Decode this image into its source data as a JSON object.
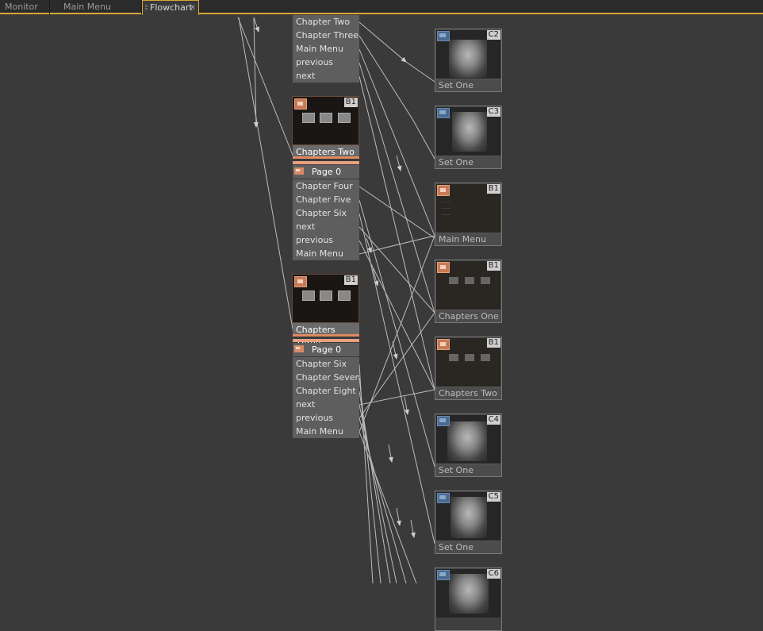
{
  "tabs": [
    {
      "label": "Monitor"
    },
    {
      "label": "Main Menu"
    },
    {
      "label": "Flowchart",
      "active": true,
      "close": "×"
    }
  ],
  "menu_top": {
    "rows": [
      "Chapter Two",
      "Chapter Three",
      "Main Menu",
      "previous",
      "next"
    ]
  },
  "menu_b1a": {
    "tag": "B1",
    "label": "Chapters Two",
    "page": "Page 0",
    "rows": [
      "Chapter Four",
      "Chapter Five",
      "Chapter Six",
      "next",
      "previous",
      "Main Menu"
    ]
  },
  "menu_b1b": {
    "tag": "B1",
    "label": "Chapters Three",
    "page": "Page 0",
    "rows": [
      "Chapter Six",
      "Chapter Seven",
      "Chapter Eight",
      "next",
      "previous",
      "Main Menu"
    ]
  },
  "nodes": [
    {
      "tag": "C2",
      "label": "Set One"
    },
    {
      "tag": "C3",
      "label": "Set One"
    },
    {
      "tag": "B1",
      "label": "Main Menu"
    },
    {
      "tag": "B1",
      "label": "Chapters One"
    },
    {
      "tag": "B1",
      "label": "Chapters Two"
    },
    {
      "tag": "C4",
      "label": "Set One"
    },
    {
      "tag": "C5",
      "label": "Set One"
    },
    {
      "tag": "C6",
      "label": ""
    }
  ],
  "colors": {
    "background": "#3a3a3a",
    "tab_accent": "#d8a838",
    "menu_accent": "#e08860",
    "line": "#bdbdbd"
  },
  "icons": [
    "menu-emblem-icon",
    "film-clip-icon",
    "tab-grip-icon",
    "close-icon"
  ]
}
